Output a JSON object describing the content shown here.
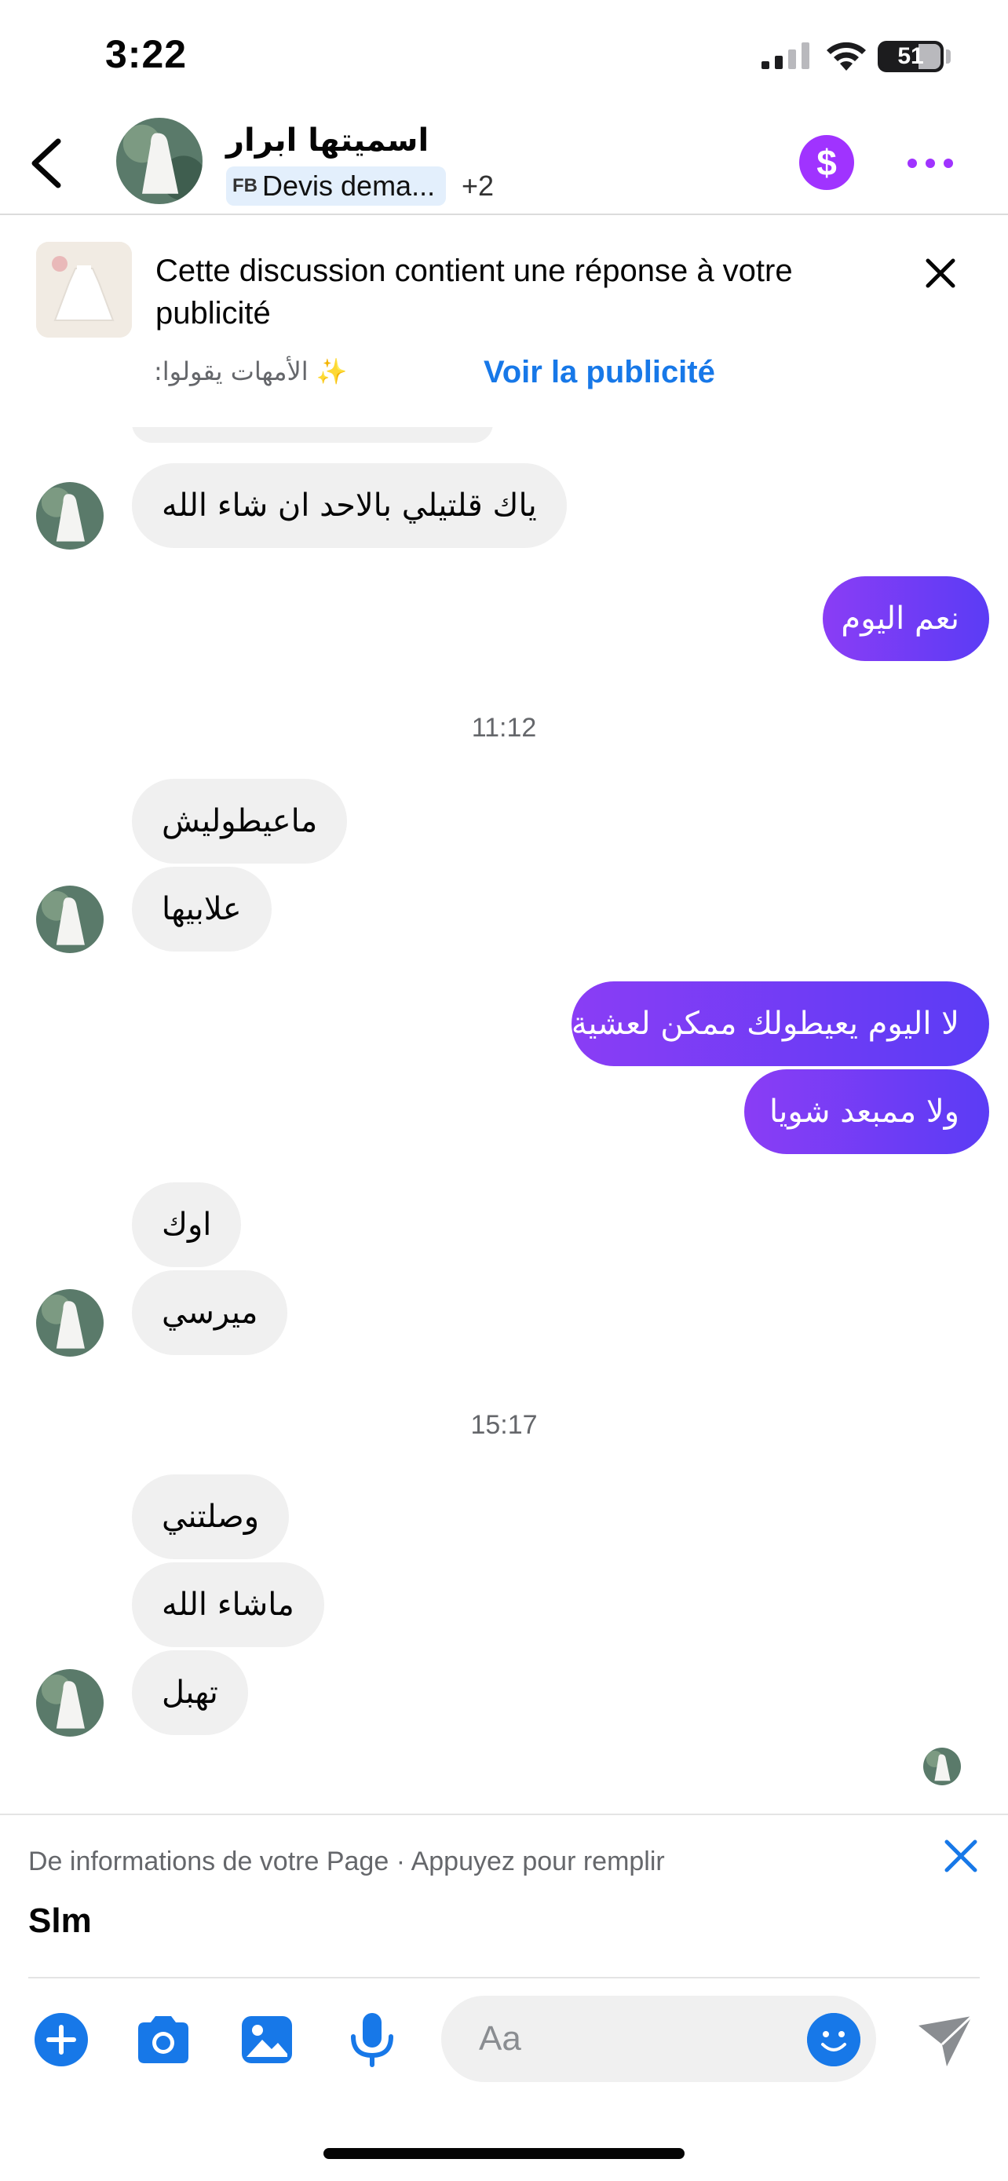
{
  "status_bar": {
    "time": "3:22",
    "battery": "51"
  },
  "header": {
    "contact_name": "اسميتها ابرار",
    "chip_tag": "FB",
    "chip_label": "Devis dema...",
    "chip_more": "+2"
  },
  "ad_banner": {
    "text": "Cette discussion contient une réponse à votre publicité",
    "caption": "✨ الأمهات يقولوا:",
    "link": "Voir la publicité"
  },
  "messages": {
    "in_1": "ياك قلتيلي بالاحد ان شاء الله",
    "out_1": "نعم اليوم",
    "time_1": "11:12",
    "in_2": "ماعيطوليش",
    "in_3": "علابيها",
    "out_2": "لا اليوم يعيطولك ممكن لعشية",
    "out_3": "ولا ممبعد شويا",
    "in_4": "اوك",
    "in_5": "ميرسي",
    "time_2": "15:17",
    "in_6": "وصلتني",
    "in_7": "ماشاء الله",
    "in_8": "تهبل"
  },
  "suggestion": {
    "hint": "De informations de votre Page · Appuyez pour remplir",
    "value": "Slm"
  },
  "composer": {
    "placeholder": "Aa"
  },
  "colors": {
    "accent_purple": "#7a3cf5",
    "brand_blue": "#1778e8",
    "incoming_bubble": "#f0f0f0"
  }
}
